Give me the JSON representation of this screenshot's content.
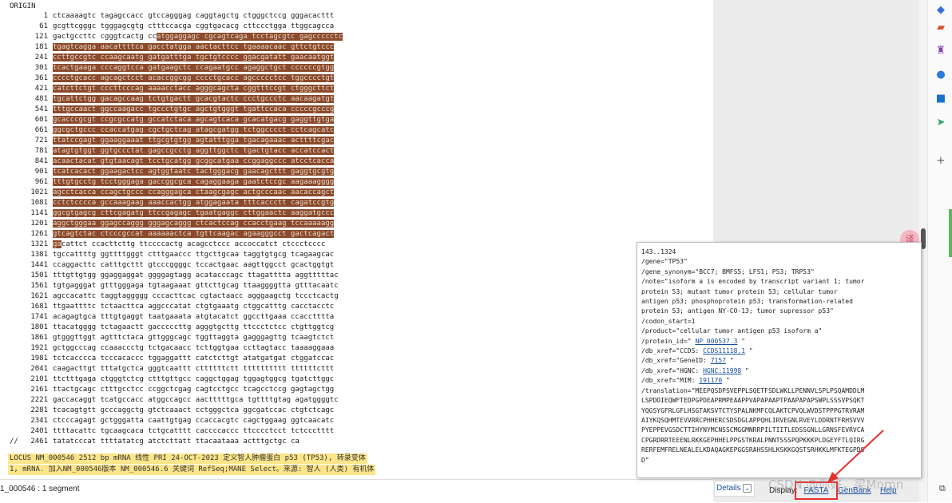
{
  "origin_label": "ORIGIN",
  "sequence_rows": [
    {
      "num": "1",
      "parts": [
        {
          "t": "ctcaaaagtc tagagccacc gtccagggag caggtagctg ctgggctccg gggacacttt",
          "h": false
        }
      ]
    },
    {
      "num": "61",
      "parts": [
        {
          "t": "gcgttcgggc tgggagcgtg ctttccacga cggtgacacg cttccctgga ttggcagcca",
          "h": false
        }
      ]
    },
    {
      "num": "121",
      "parts": [
        {
          "t": "gactgccttc cgggtcactg cc",
          "h": false
        },
        {
          "t": "atggaggagc cgcagtcaga tcctagcgtc gagccccctc",
          "h": true
        }
      ]
    },
    {
      "num": "181",
      "parts": [
        {
          "t": "tgagtcagga aacattttca gacctatgga aactacttcc tgaaaacaac gttctgtccc",
          "h": true
        }
      ]
    },
    {
      "num": "241",
      "parts": [
        {
          "t": "ccttgccgtc ccaagcaatg gatgatttga tgctgtcccc ggacgatatt gaacaatggt",
          "h": true
        }
      ]
    },
    {
      "num": "301",
      "parts": [
        {
          "t": "tcactgaaga cccaggtcca gatgaagctc ccagaatgcc agaggctgct ccccccgtgg",
          "h": true
        }
      ]
    },
    {
      "num": "361",
      "parts": [
        {
          "t": "cccctgcacc agcagctcct acaccggcgg cccctgcacc agccccctcc tggcccctgt",
          "h": true
        }
      ]
    },
    {
      "num": "421",
      "parts": [
        {
          "t": "catcttctgt cccttcccag aaaacctacc agggcagcta cggtttccgt ctgggcttct",
          "h": true
        }
      ]
    },
    {
      "num": "481",
      "parts": [
        {
          "t": "tgcattctgg gacagccaag tctgtgactt gcacgtactc ccctgccctc aacaagatgt",
          "h": true
        }
      ]
    },
    {
      "num": "541",
      "parts": [
        {
          "t": "tttgccaact ggccaagacc tgccctgtgc agctgtgggt tgattccaca cccccgcccg",
          "h": true
        }
      ]
    },
    {
      "num": "601",
      "parts": [
        {
          "t": "gcacccgcgt ccgcgccatg gccatctaca agcagtcaca gcacatgacg gaggttgtga",
          "h": true
        }
      ]
    },
    {
      "num": "661",
      "parts": [
        {
          "t": "ggcgctgccc ccaccatgag cgctgctcag atagcgatgg tctggcccct cctcagcatc",
          "h": true
        }
      ]
    },
    {
      "num": "721",
      "parts": [
        {
          "t": "ttatccgagt ggaaggaaat ttgcgtgtgg agtatttgga tgacagaaac acttttcgac",
          "h": true
        }
      ]
    },
    {
      "num": "781",
      "parts": [
        {
          "t": "atagtgtggt ggtgccctat gagccgcctg aggttggctc tgactgtacc accatccact",
          "h": true
        }
      ]
    },
    {
      "num": "841",
      "parts": [
        {
          "t": "acaactacat gtgtaacagt tcctgcatgg gcggcatgaa ccggaggccc atcctcacca",
          "h": true
        }
      ]
    },
    {
      "num": "901",
      "parts": [
        {
          "t": "tcatcacact ggaagactcc agtggtaatc tactgggacg gaacagcttt gaggtgcgtg",
          "h": true
        }
      ]
    },
    {
      "num": "961",
      "parts": [
        {
          "t": "tttgtgcctg tcctgggaga gaccggcgca cagaggaaga gaatctccgc aagaaagggg",
          "h": true
        }
      ]
    },
    {
      "num": "1021",
      "parts": [
        {
          "t": "agcctcacca ccagctgccc ccagggagca ctaagcgagc actgcccaac aacaccagct",
          "h": true
        }
      ]
    },
    {
      "num": "1081",
      "parts": [
        {
          "t": "cctctcccca gccaaagaag aaaccactgg atggagaata tttcaccctt cagatccgtg",
          "h": true
        }
      ]
    },
    {
      "num": "1141",
      "parts": [
        {
          "t": "ggcgtgagcg cttcgagatg ttccgagagc tgaatgaggc cttggaactc aaggatgccc",
          "h": true
        }
      ]
    },
    {
      "num": "1201",
      "parts": [
        {
          "t": "aggctgggaa ggagccaggg gggagcaggg ctcactccag ccacctgaag tccaaaaagg",
          "h": true
        }
      ]
    },
    {
      "num": "1261",
      "parts": [
        {
          "t": "gtcagtctac ctcccgccat aaaaaactca tgttcaagac agaagggcct gactcagact",
          "h": true
        }
      ]
    },
    {
      "num": "1321",
      "parts": [
        {
          "t": "ga",
          "h": true
        },
        {
          "t": "cattct ccacttcttg ttccccactg acagcctccc accoccatct ctccctcccc",
          "h": false
        }
      ]
    },
    {
      "num": "1381",
      "parts": [
        {
          "t": "tgccattttg ggttttgggt ctttgaaccc ttgcttgcaa taggtgtgcg tcagaagcac",
          "h": false
        }
      ]
    },
    {
      "num": "1441",
      "parts": [
        {
          "t": "ccaggacttc catttgcttt gtcccggggc tccactgaac aagttggcct gcactggtgt",
          "h": false
        }
      ]
    },
    {
      "num": "1501",
      "parts": [
        {
          "t": "tttgttgtgg ggaggaggat ggggagtagg acatacccagc ttagatttta aggtttttac",
          "h": false
        }
      ]
    },
    {
      "num": "1561",
      "parts": [
        {
          "t": "tgtgagggat gtttgggaga tgtaagaaat gttcttgcag ttaaggggtta gtttacaatc",
          "h": false
        }
      ]
    },
    {
      "num": "1621",
      "parts": [
        {
          "t": "agccacattc taggtaggggg cccacttcac cgtactaacc agggaagctg tccctcactg",
          "h": false
        }
      ]
    },
    {
      "num": "1681",
      "parts": [
        {
          "t": "ttgaattttc tctaacttca aggcccatat ctgtgaaatg ctggcatttg cacctacctc",
          "h": false
        }
      ]
    },
    {
      "num": "1741",
      "parts": [
        {
          "t": "acagagtgca tttgtgaggt taatgaaata atgtacatct ggccttgaaa ccaccttttа",
          "h": false
        }
      ]
    },
    {
      "num": "1801",
      "parts": [
        {
          "t": "ttacatgggg tctagaactt gacccccttg agggtgcttg ttccctctcc ctgttggtcg",
          "h": false
        }
      ]
    },
    {
      "num": "1861",
      "parts": [
        {
          "t": "gtgggttggt agtttctaca gttgggcagc tggttaggta gagggagttg tcaagtctct",
          "h": false
        }
      ]
    },
    {
      "num": "1921",
      "parts": [
        {
          "t": "gctggcccag ccaaaccctg tctgacaacc tcttggtgaa ccttagtacc taaaaggaaa",
          "h": false
        }
      ]
    },
    {
      "num": "1981",
      "parts": [
        {
          "t": "tctcacccca tcccacaccc tggaggattt catctcttgt atatgatgat ctggatccac",
          "h": false
        }
      ]
    },
    {
      "num": "2041",
      "parts": [
        {
          "t": "caagacttgt tttatgctca gggtcaattt cttttttctt tttttttttt ttttttcttt",
          "h": false
        }
      ]
    },
    {
      "num": "2101",
      "parts": [
        {
          "t": "ttctttgaga ctgggtctcg ctttgttgcc caggctggag tggagtggcg tgatcttggc",
          "h": false
        }
      ]
    },
    {
      "num": "2161",
      "parts": [
        {
          "t": "ttactgcagc ctttgcctcc ccggctcgag cagtcctgcc tcagcctccg gagtagctgg",
          "h": false
        }
      ]
    },
    {
      "num": "2221",
      "parts": [
        {
          "t": "gaccacaggt tcatgccacc atggccagcc aactttttgca tgttttgtag agatggggtc",
          "h": false
        }
      ]
    },
    {
      "num": "2281",
      "parts": [
        {
          "t": "tcacagtgtt gcccaggctg gtctcaaact cctgggctca ggcgatccac ctgtctcagc",
          "h": false
        }
      ]
    },
    {
      "num": "2341",
      "parts": [
        {
          "t": "ctcccagagt gctgggatta caattgtgag ccaccacgtc cagctggaag ggtcaacatc",
          "h": false
        }
      ]
    },
    {
      "num": "2401",
      "parts": [
        {
          "t": "ttttacattc tgcaagcaca tctgcatttt caccccaccc ttcccctcct tctccctttt",
          "h": false
        }
      ]
    },
    {
      "num": "2461",
      "parts": [
        {
          "t": "tatatcccat ttttatatcg atctcttatt ttacaataaa actttgctgc ca",
          "h": false
        }
      ]
    }
  ],
  "end_marker": "//",
  "locus_line1": "LOCUS NM_000546 2512 bp mRNA 线性 PRI 24-OCT-2023 定义智人肿瘤蛋白 p53 (TP53), 转录变体",
  "locus_line2": "1, mRNA. 加入NM_000546版本 NM_000546.6 关键词 RefSeq;MANE Select。来源: 智人 (人类) 有机体",
  "status_segment": "1_000546 : 1 segment",
  "popup": {
    "lines": [
      [
        {
          "t": "143..1324"
        }
      ],
      [
        {
          "t": "/gene=\"TP53\""
        }
      ],
      [
        {
          "t": "/gene_synonym=\"BCC7; BMFS5; LFS1; P53; TRP53\""
        }
      ],
      [
        {
          "t": "/note=\"isoform a is encoded by transcript variant 1; tumor"
        }
      ],
      [
        {
          "t": "protein 53; mutant tumor protein 53; cellular tumor"
        }
      ],
      [
        {
          "t": "antigen p53; phosphoprotein p53; transformation-related"
        }
      ],
      [
        {
          "t": "protein 53; antigen NY-CO-13; tumor supressor p53\""
        }
      ],
      [
        {
          "t": "/codon_start=1"
        }
      ],
      [
        {
          "t": "/product=\"cellular tumor antigen p53 isoform a\""
        }
      ],
      [
        {
          "t": "/protein_id=\" "
        },
        {
          "t": "NP_000537.3",
          "link": true
        },
        {
          "t": " \""
        }
      ],
      [
        {
          "t": "/db_xref=\"CCDS: "
        },
        {
          "t": "CCDS11118.1",
          "link": true
        },
        {
          "t": " \""
        }
      ],
      [
        {
          "t": "/db_xref=\"GeneID: "
        },
        {
          "t": "7157",
          "link": true
        },
        {
          "t": " \""
        }
      ],
      [
        {
          "t": "/db_xref=\"HGNC: "
        },
        {
          "t": "HGNC:11998",
          "link": true
        },
        {
          "t": " \""
        }
      ],
      [
        {
          "t": "/db_xref=\"MIM: "
        },
        {
          "t": "191170",
          "link": true
        },
        {
          "t": " \""
        }
      ],
      [
        {
          "t": "/translation=\"MEEPQSDPSVEPPLSQETFSDLWKLLPENNVLSPLPSQAMDDLM"
        }
      ],
      [
        {
          "t": "LSPDDIEQWFTEDPGPDEAPRMPEAAPPVAPAPAAPTPAAPAPAPSWPLSSSVPSQKT"
        }
      ],
      [
        {
          "t": "YQGSYGFRLGFLHSGTAKSVTCTYSPALNKMFCQLAKTCPVQLWVDSTPPPGTRVRAM"
        }
      ],
      [
        {
          "t": "AIYKQSQHMTEVVRRCPHHERCSDSDGLAPPQHLIRVEGNLRVEYLDDRNTFRHSVVV"
        }
      ],
      [
        {
          "t": "PYEPPEVGSDCTTIHYNYMCNSSCMGGMNRRPILTIITLEDSSGNLLGRNSFEVRVCA"
        }
      ],
      [
        {
          "t": "CPGRDRRTEEENLRKKGEPHHELPPGSTKRALPNNTSSSPQPKKKPLDGEYFTLQIRG"
        }
      ],
      [
        {
          "t": "RERFEMFRELNEALELKDAQAGKEPGGSRAHSSHLKSKKGQSTSRHKKLMFKTEGPDS"
        }
      ],
      [
        {
          "t": "D\""
        }
      ]
    ]
  },
  "footer": {
    "details_label": "Details",
    "display_label": "Display:",
    "fasta_label": "FASTA",
    "genbank_label": "GenBank",
    "help_label": "Help"
  },
  "watermark_text": "CSDN @你好，梁Mnmn",
  "translate_badge": "译",
  "sidebar_icons": [
    "tag-icon",
    "toolbox-icon",
    "chess-icon",
    "office-icon",
    "outlook-icon",
    "send-icon",
    "add-icon"
  ],
  "colors": {
    "highlight": "#8a4a2b",
    "locus_bg": "#fde58a",
    "link": "#1a4fa0",
    "fasta_box": "#e53030"
  }
}
